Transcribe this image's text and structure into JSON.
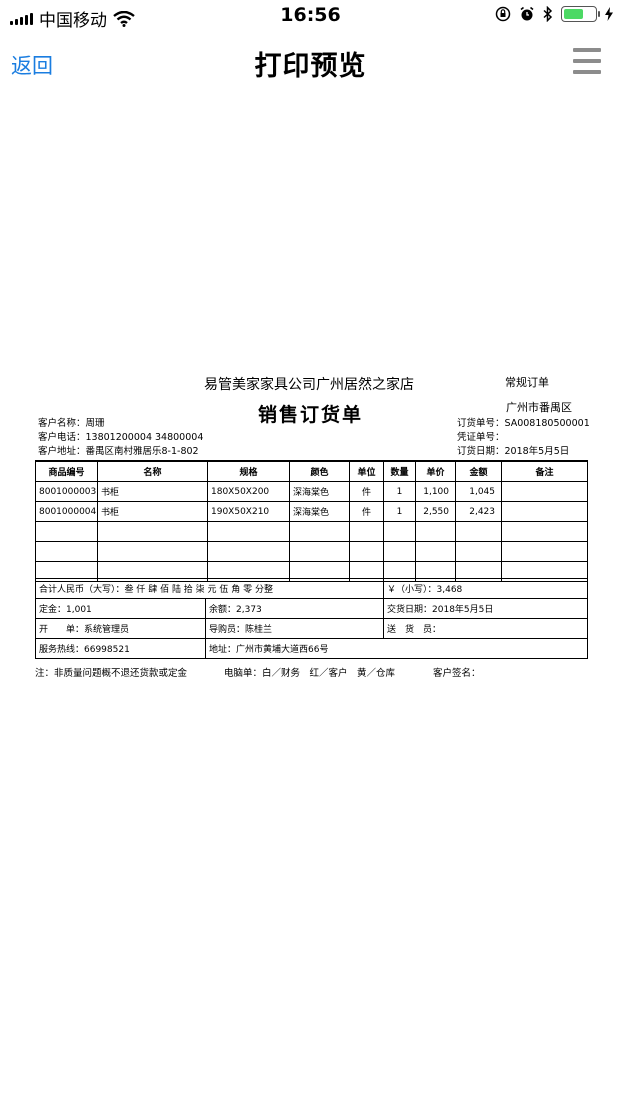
{
  "status_bar": {
    "carrier": "中国移动",
    "time": "16:56",
    "battery_level": 0.6,
    "battery_color": "#4cd964"
  },
  "nav": {
    "back_label": "返回",
    "title": "打印预览",
    "menu_icon": "hamburger-menu-icon"
  },
  "document": {
    "company": "易管美家家具公司广州居然之家店",
    "title": "销售订货单",
    "order_type": "常规订单",
    "district": "广州市番禺区",
    "customer_name": "客户名称：周珊",
    "customer_phone": "客户电话：13801200004 34800004",
    "customer_address": "客户地址：番禺区南村雅居乐8-1-802",
    "order_no": "订货单号：SA008180500001",
    "voucher_no": "凭证单号：",
    "order_date": "订货日期：2018年5月5日",
    "table": {
      "headers": [
        "商品编号",
        "名称",
        "规格",
        "颜色",
        "单位",
        "数量",
        "单价",
        "金额",
        "备注"
      ],
      "rows": [
        [
          "8001000003",
          "书柜",
          "180X50X200",
          "深海棠色",
          "件",
          "1",
          "1,100",
          "1,045",
          ""
        ],
        [
          "8001000004",
          "书柜",
          "190X50X210",
          "深海棠色",
          "件",
          "1",
          "2,550",
          "2,423",
          ""
        ],
        [
          "",
          "",
          "",
          "",
          "",
          "",
          "",
          "",
          ""
        ],
        [
          "",
          "",
          "",
          "",
          "",
          "",
          "",
          "",
          ""
        ],
        [
          "",
          "",
          "",
          "",
          "",
          "",
          "",
          "",
          ""
        ]
      ]
    },
    "total_upper": "合计人民币（大写）：叁 仟 肆 佰 陆 拾 柒 元 伍 角 零 分整",
    "total_lower": "￥（小写）：3,468",
    "deposit": "定金：1,001",
    "balance": "余额：2,373",
    "delivery_date": "交货日期：2018年5月5日",
    "issuer": "开　　单：系统管理员",
    "guide": "导购员：陈桂兰",
    "deliverer": "送　货　员：",
    "hotline": "服务热线：66998521",
    "address": "地址：广州市黄埔大道西66号",
    "note": "注：非质量问题概不退还货款或定金",
    "copies": "电脑单：白／财务　红／客户　黄／仓库",
    "signature": "客户签名："
  }
}
